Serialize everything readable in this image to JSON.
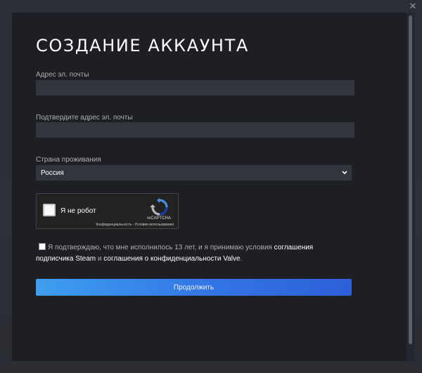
{
  "window": {
    "close_symbol": "✕"
  },
  "form": {
    "title": "СОЗДАНИЕ АККАУНТА",
    "email_label": "Адрес эл. почты",
    "email_value": "",
    "confirm_label": "Подтвердите адрес эл. почты",
    "confirm_value": "",
    "country_label": "Страна проживания",
    "country_selected": "Россия",
    "captcha": {
      "label": "Я не робот",
      "brand": "reCAPTCHA",
      "privacy": "Конфиденциальность",
      "separator": " - ",
      "terms": "Условия использования"
    },
    "agreement": {
      "text_before": "Я подтверждаю, что мне исполнилось 13 лет, и я принимаю условия ",
      "link_subscriber": "соглашения подписчика Steam",
      "text_middle": " и ",
      "link_privacy": "соглашения о конфиденциальности Valve",
      "text_after": "."
    },
    "continue_label": "Продолжить"
  },
  "colors": {
    "background": "#2a2d34",
    "panel": "#1d1f25",
    "input": "#32353c",
    "button_start": "#3e9fef",
    "button_end": "#2d60d8"
  },
  "icons": [
    "close-icon",
    "chevron-down-icon",
    "recaptcha-logo-icon"
  ]
}
